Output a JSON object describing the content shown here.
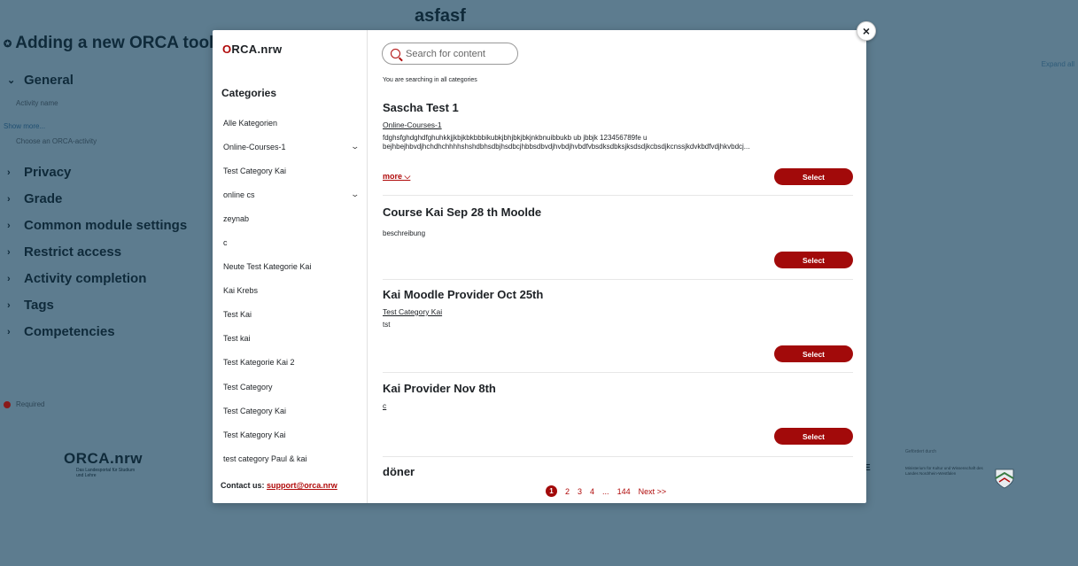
{
  "background": {
    "course_title": "asfasf",
    "heading": "Adding a new ORCA tool",
    "expand_all": "Expand all",
    "sections": [
      {
        "label": "General",
        "expanded": true
      },
      {
        "label": "Privacy",
        "expanded": false
      },
      {
        "label": "Grade",
        "expanded": false
      },
      {
        "label": "Common module settings",
        "expanded": false
      },
      {
        "label": "Restrict access",
        "expanded": false
      },
      {
        "label": "Activity completion",
        "expanded": false
      },
      {
        "label": "Tags",
        "expanded": false
      },
      {
        "label": "Competencies",
        "expanded": false
      }
    ],
    "activity_name": "Activity name",
    "show_more": "Show more...",
    "choose_activity": "Choose an ORCA-activity",
    "required": "Required",
    "footer_logo": "ORCA.nrw",
    "footer_logo_sub": "Das Landesportal für Studium und Lehre",
    "funded_by": "Gefördert durch",
    "ministry": "Ministerium für Kultur und Wissenschaft des Landes Nordrhein-Westfalen",
    "partial_letter": "E"
  },
  "modal": {
    "close_icon": "×",
    "logo": {
      "first": "O",
      "rest": "RCA.nrw"
    },
    "categories_title": "Categories",
    "categories": [
      {
        "label": "Alle Kategorien",
        "has_children": false
      },
      {
        "label": "Online-Courses-1",
        "has_children": true
      },
      {
        "label": "Test Category Kai",
        "has_children": false
      },
      {
        "label": "online cs",
        "has_children": true
      },
      {
        "label": "zeynab",
        "has_children": false
      },
      {
        "label": "c",
        "has_children": false
      },
      {
        "label": "Neute Test Kategorie Kai",
        "has_children": false
      },
      {
        "label": "Kai Krebs",
        "has_children": false
      },
      {
        "label": "Test Kai",
        "has_children": false
      },
      {
        "label": "Test kai",
        "has_children": false
      },
      {
        "label": "Test Kategorie Kai 2",
        "has_children": false
      },
      {
        "label": "Test Category",
        "has_children": false
      },
      {
        "label": "Test Category Kai",
        "has_children": false
      },
      {
        "label": "Test Kategory Kai",
        "has_children": false
      },
      {
        "label": "test category Paul & kai",
        "has_children": false
      }
    ],
    "contact_label": "Contact us:",
    "contact_email": "support@orca.nrw",
    "search_placeholder": "Search for content",
    "searching_text": "You are searching in all categories",
    "results": [
      {
        "title": "Sascha Test 1",
        "category": "Online-Courses-1",
        "description": "fdghsfghdghdfghuhkkjjkbjkbkbbbikubkjbhjbkjbkjnkbnuibbukb ub jbbjk 123456789fe u bejhbejhbvdjhchdhchhhhshshdbhsdbjhsdbcjhbbsdbvdjhvbdjhvbdfvbsdksdbksjksdsdjkcbsdjkcnssjkdvkbdfvdjhkvbdcj...",
        "more": "more",
        "select": "Select"
      },
      {
        "title": "Course Kai Sep 28 th Moolde",
        "category": "",
        "description": "beschreibung",
        "select": "Select"
      },
      {
        "title": "Kai Moodle Provider Oct 25th",
        "category": "Test Category Kai",
        "description": "tst",
        "select": "Select"
      },
      {
        "title": "Kai Provider Nov 8th",
        "category": "c",
        "description": "",
        "select": "Select"
      },
      {
        "title": "döner"
      }
    ],
    "pagination": {
      "current": "1",
      "pages": [
        "2",
        "3",
        "4"
      ],
      "ellipsis": "...",
      "last": "144",
      "next": "Next >>"
    }
  },
  "colors": {
    "accent": "#a20a0a",
    "backdrop": "#5d7c8f"
  }
}
